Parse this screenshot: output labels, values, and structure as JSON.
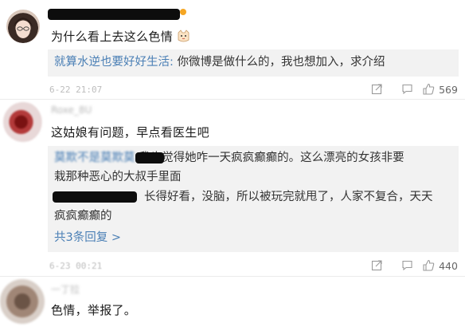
{
  "comments": [
    {
      "text": "为什么看上去这么色情",
      "emoji": "cat-face-icon",
      "reply": {
        "author": "就算水逆也要好好生活:",
        "text": " 你微博是做什么的，我也想加入，求介绍"
      },
      "timestamp": "6-22 21:07",
      "like_count": "569"
    },
    {
      "username": "Roxe_8U",
      "text": "这姑娘有问题，早点看医生吧",
      "reply_1": {
        "author": "莫欺不是莫欺莫",
        "text_line1": " 我也觉得她咋一天疯疯癫癫的。这么漂亮的女孩非要",
        "text_line2": "栽那种恶心的大叔手里面"
      },
      "reply_2": {
        "text_line1": "长得好看，没脑，所以被玩完就甩了，人家不复合，天天",
        "text_line2": "疯疯癫癫的"
      },
      "more_replies": "共3条回复 >",
      "timestamp": "6-23 00:21",
      "like_count": "440"
    },
    {
      "username": "一丁拉",
      "text": "色情，举报了。"
    }
  ],
  "colors": {
    "link": "#4a7fb5",
    "reply_bg": "#f2f2f2"
  }
}
